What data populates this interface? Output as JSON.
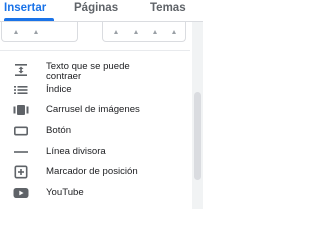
{
  "tabs": [
    {
      "label": "Insertar",
      "active": true
    },
    {
      "label": "Páginas",
      "active": false
    },
    {
      "label": "Temas",
      "active": false
    }
  ],
  "items": [
    {
      "label_line1": "Texto que se puede",
      "label_line2": "contraer",
      "icon": "collapsible-text-icon"
    },
    {
      "label": "Índice",
      "icon": "table-of-contents-icon"
    },
    {
      "label": "Carrusel de imágenes",
      "icon": "image-carousel-icon"
    },
    {
      "label": "Botón",
      "icon": "button-icon"
    },
    {
      "label": "Línea divisora",
      "icon": "divider-icon"
    },
    {
      "label": "Marcador de posición",
      "icon": "placeholder-icon"
    },
    {
      "label": "YouTube",
      "icon": "youtube-icon"
    }
  ],
  "colors": {
    "accent": "#1a73e8",
    "text": "#202124",
    "icon": "#5f6368"
  }
}
